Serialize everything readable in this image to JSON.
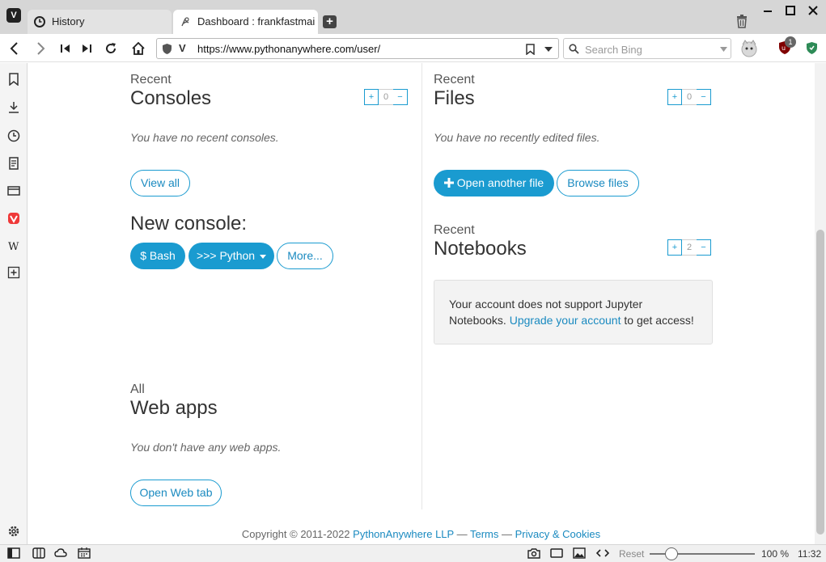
{
  "browser": {
    "tabs": [
      {
        "title": "History",
        "icon": "clock-icon"
      },
      {
        "title": "Dashboard : frankfastmailc",
        "icon": "pythonanywhere-icon"
      }
    ],
    "url": "https://www.pythonanywhere.com/user/",
    "search_placeholder": "Search Bing",
    "ublock_badge": "1"
  },
  "consoles": {
    "kicker": "Recent",
    "title": "Consoles",
    "count": "0",
    "empty": "You have no recent consoles.",
    "view_all": "View all",
    "new_console_title": "New console:",
    "bash": "$ Bash",
    "python": ">>> Python",
    "more": "More..."
  },
  "files": {
    "kicker": "Recent",
    "title": "Files",
    "count": "0",
    "empty": "You have no recently edited files.",
    "open_another": "Open another file",
    "browse": "Browse files"
  },
  "notebooks": {
    "kicker": "Recent",
    "title": "Notebooks",
    "count": "2",
    "notice_pre": "Your account does not support Jupyter Notebooks.",
    "notice_link": "Upgrade your account",
    "notice_post": "to get access!"
  },
  "webapps": {
    "kicker": "All",
    "title": "Web apps",
    "empty": "You don't have any web apps.",
    "open_tab": "Open Web tab"
  },
  "footer": {
    "copyright": "Copyright © 2011-2022",
    "company": "PythonAnywhere LLP",
    "sep1": "—",
    "terms": "Terms",
    "sep2": "—",
    "privacy": "Privacy & Cookies"
  },
  "statusbar": {
    "reset": "Reset",
    "zoom": "100 %",
    "clock": "11:32"
  },
  "colors": {
    "accent": "#1a9bd0",
    "link": "#1a8ac0"
  }
}
